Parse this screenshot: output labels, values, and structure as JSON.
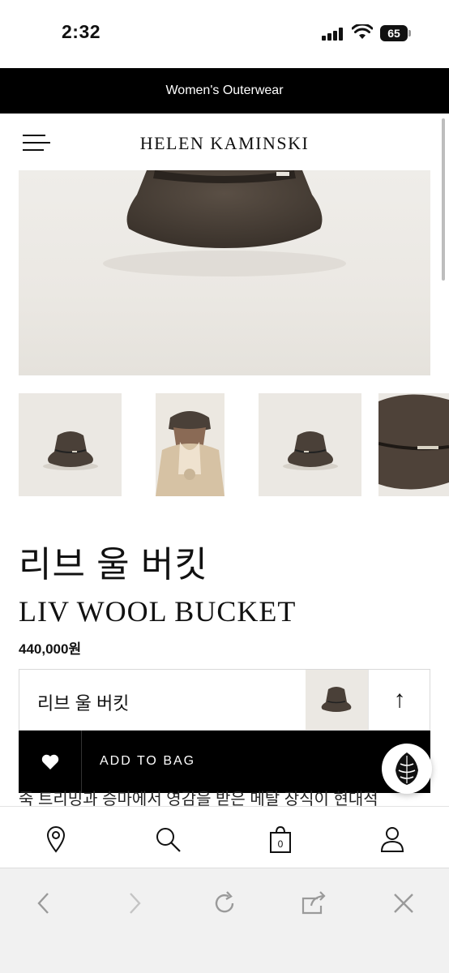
{
  "status_bar": {
    "time": "2:32",
    "battery": "65"
  },
  "promo": {
    "text": "Women's Outerwear"
  },
  "header": {
    "brand": "HELEN KAMINSKI"
  },
  "product": {
    "name_ko": "리브 울 버킷",
    "name_en": "LIV WOOL BUCKET",
    "price": "440,000원"
  },
  "sticky": {
    "name": "리브 울 버킷",
    "scroll_up_label": "↑"
  },
  "actions": {
    "add_to_bag": "ADD TO BAG",
    "wishlist_icon": "heart-icon"
  },
  "description_peek": "죽 트리밍과 승마에서 영감을 받은 메탈 장식이 현대적",
  "colors": {
    "black": "#000000",
    "hat_brown": "#4a4038",
    "background": "#ebe8e3"
  }
}
